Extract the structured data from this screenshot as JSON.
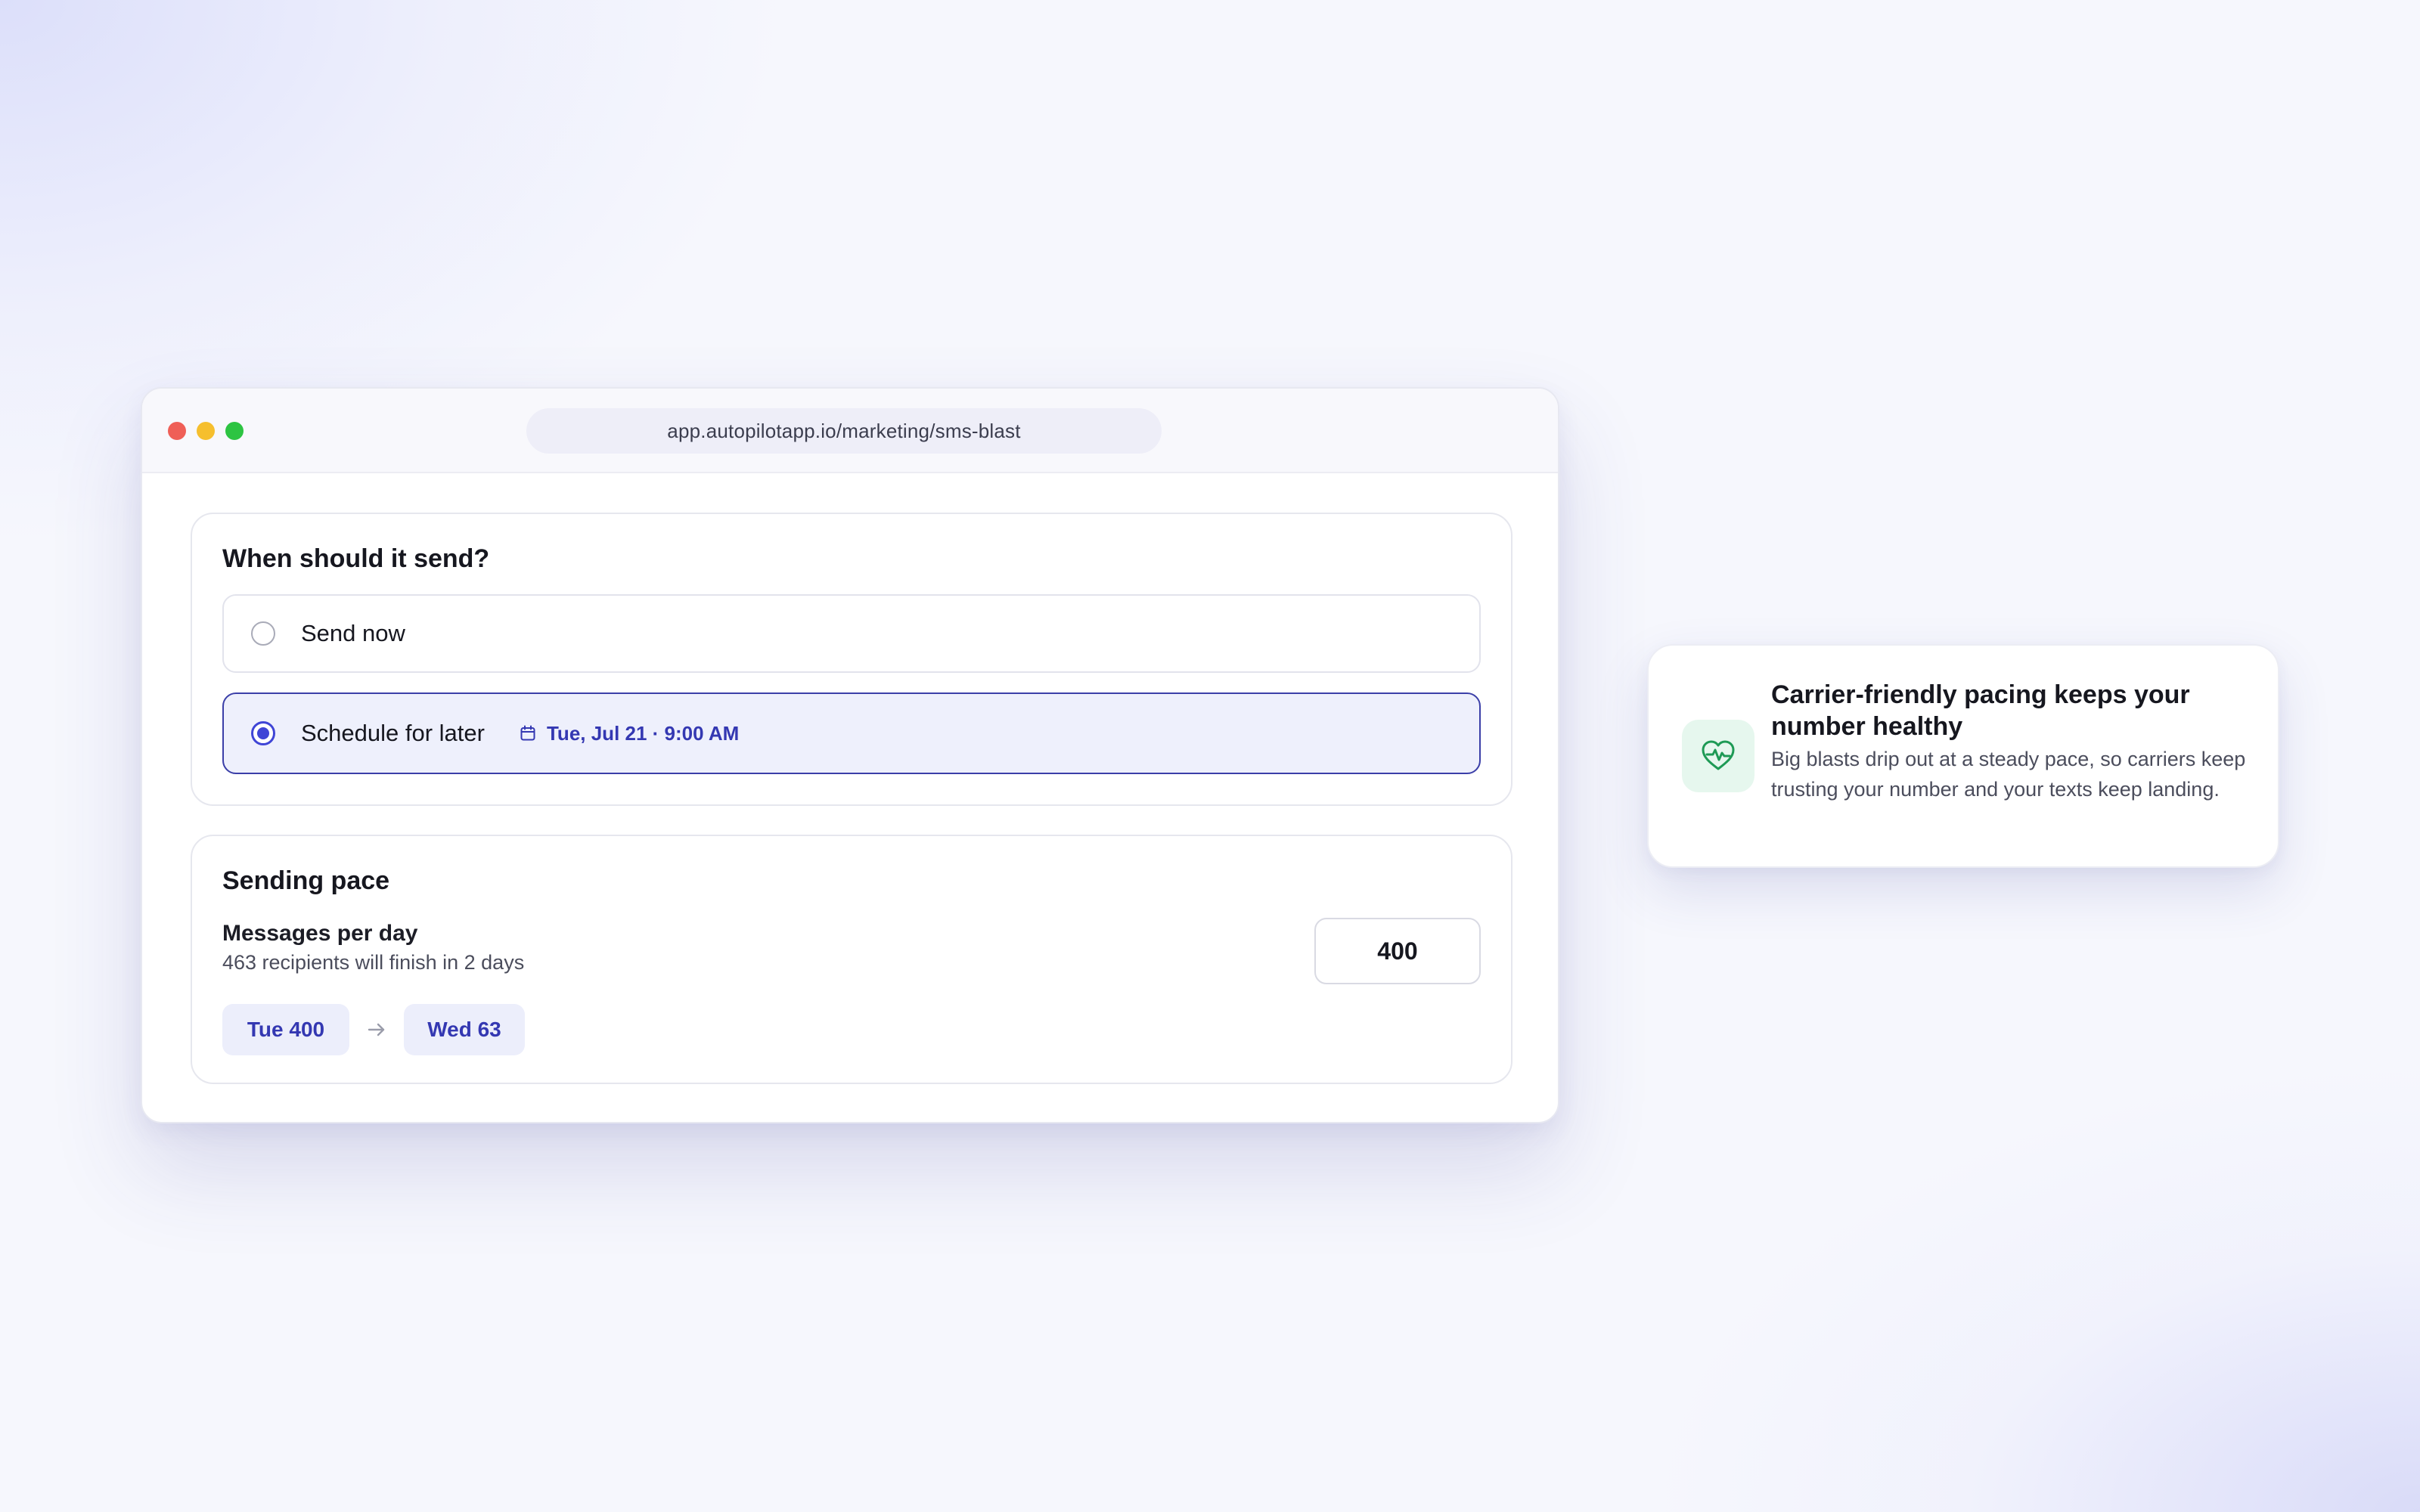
{
  "browser": {
    "url": "app.autopilotapp.io/marketing/sms-blast"
  },
  "schedule": {
    "title": "When should it send?",
    "options": [
      {
        "label": "Send now",
        "selected": false
      },
      {
        "label": "Schedule for later",
        "selected": true
      }
    ],
    "scheduled_date": "Tue, Jul 21 · 9:00 AM"
  },
  "pace": {
    "title": "Sending pace",
    "label": "Messages per day",
    "sublabel": "463 recipients will finish in 2 days",
    "messages_per_day": "400",
    "days": [
      {
        "label": "Tue 400"
      },
      {
        "label": "Wed 63"
      }
    ]
  },
  "info_card": {
    "icon": "heart-pulse-icon",
    "title": "Carrier-friendly pacing keeps your number healthy",
    "body": "Big blasts drip out at a steady pace, so carriers keep trusting your number and your texts keep landing."
  },
  "colors": {
    "accent": "#3f45d6",
    "accent_text": "#3438b2",
    "selected_bg": "#eef0fc",
    "success_icon": "#1e9a55"
  }
}
